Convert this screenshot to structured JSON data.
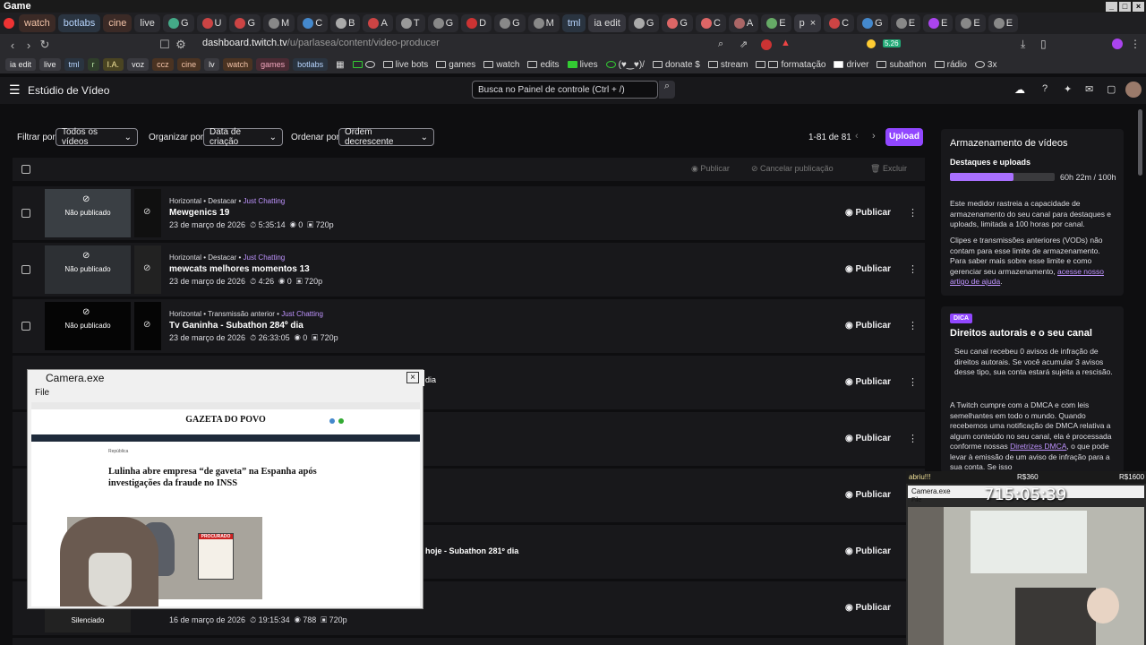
{
  "os": {
    "title": "Game"
  },
  "tabs": [
    "",
    "watch",
    "botlabs",
    "cine",
    "live",
    "G",
    "U",
    "G",
    "M",
    "C",
    "B",
    "A",
    "T",
    "G",
    "D",
    "G",
    "M",
    "tml",
    "ia edit",
    "G",
    "G",
    "C",
    "A",
    "E",
    "p",
    "C",
    "G",
    "E",
    "E",
    "E",
    "E"
  ],
  "address": {
    "host": "dashboard.twitch.tv",
    "path": "/u/parlasea/content/video-producer"
  },
  "bookmarks": {
    "chips": [
      "ia edit",
      "live",
      "tml",
      "r",
      "I.A.",
      "voz",
      "ccz",
      "cine",
      "lv",
      "watch",
      "games",
      "botlabs"
    ],
    "items": [
      "live bots",
      "games",
      "watch",
      "edits",
      "lives",
      "(♥‿♥)/",
      "donate $",
      "stream",
      "formatação",
      "driver",
      "subathon",
      "rádio",
      "3x"
    ],
    "badge": "5.26"
  },
  "header": {
    "title": "Estúdio de Vídeo",
    "search_placeholder": "Busca no Painel de controle (Ctrl + /)"
  },
  "filters": {
    "filter_label": "Filtrar por",
    "filter_value": "Todos os vídeos",
    "organize_label": "Organizar por",
    "organize_value": "Data de criação",
    "order_label": "Ordenar por",
    "order_value": "Ordem decrescente",
    "count": "1-81 de 81",
    "upload": "Upload"
  },
  "bulk": {
    "publish": "Publicar",
    "unpublish": "Cancelar publicação",
    "delete": "Excluir"
  },
  "unpublished_label": "Não publicado",
  "publish_label": "Publicar",
  "videos": [
    {
      "meta": "Horizontal • Destacar • ",
      "category": "Just Chatting",
      "title": "Mewgenics 19",
      "date": "23 de março de 2026",
      "duration": "5:35:14",
      "views": "0",
      "quality": "720p"
    },
    {
      "meta": "Horizontal • Destacar • ",
      "category": "Just Chatting",
      "title": "mewcats melhores momentos 13",
      "date": "23 de março de 2026",
      "duration": "4:26",
      "views": "0",
      "quality": "720p"
    },
    {
      "meta": "Horizontal • Transmissão anterior • ",
      "category": "Just Chatting",
      "title": "Tv Ganinha - Subathon 284º dia",
      "date": "23 de março de 2026",
      "duration": "26:33:05",
      "views": "0",
      "quality": "720p"
    }
  ],
  "partial": {
    "row4": "dia",
    "row7": "hoje - Subathon 281º dia",
    "row9_label": "Silenciado",
    "row9_date": "16 de março de 2026",
    "row9_duration": "19:15:34",
    "row9_views": "788",
    "row9_quality": "720p"
  },
  "storage": {
    "heading": "Armazenamento de vídeos",
    "sub": "Destaques e uploads",
    "value": "60h 22m / 100h",
    "fill": 0.6037,
    "p1": "Este medidor rastreia a capacidade de armazenamento do seu canal para destaques e uploads, limitada a 100 horas por canal.",
    "p2": "Clipes e transmissões anteriores (VODs) não contam para esse limite de armazenamento. Para saber mais sobre esse limite e como gerenciar seu armazenamento, ",
    "link": "acesse nosso artigo de ajuda",
    "p2end": "."
  },
  "dmca": {
    "tag": "DICA",
    "heading": "Direitos autorais e o seu canal",
    "p1": "Seu canal recebeu 0 avisos de infração de direitos autorais. Se você acumular 3 avisos desse tipo, sua conta estará sujeita a rescisão.",
    "p2": "A Twitch cumpre com a DMCA e com leis semelhantes em todo o mundo. Quando recebemos uma notificação de DMCA relativa a algum conteúdo no seu canal, ela é processada conforme nossas ",
    "link": "Diretrizes DMCA",
    "p2end": ", o que pode levar à emissão de um aviso de infração para a sua conta. Se isso"
  },
  "camera": {
    "title": "Camera.exe",
    "menu": "File",
    "site": "GAZETA DO POVO",
    "section": "República",
    "headline": "Lulinha abre empresa “de gaveta” na Espanha após investigações da fraude no INSS",
    "sign": "PROCURADO"
  },
  "webcam": {
    "left": "abriu!!!",
    "mid": "R$360",
    "right": "R$1600",
    "title": "Camera.exe",
    "timer": "715:05:39",
    "menu": "File"
  }
}
